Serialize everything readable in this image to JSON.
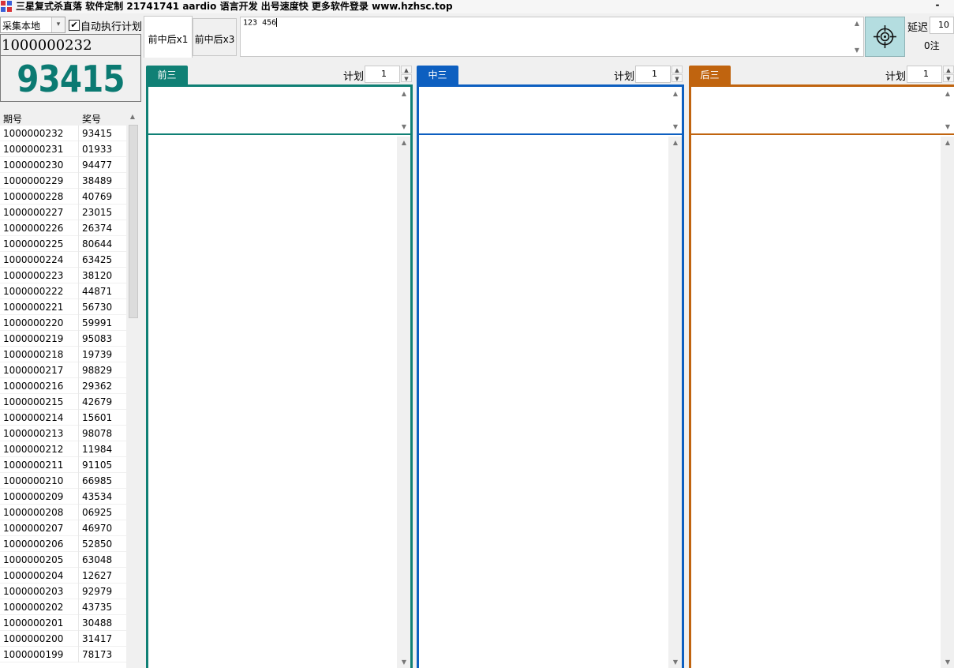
{
  "window": {
    "title": "三星复式杀直落 软件定制 21741741 aardio 语言开发 出号速度快 更多软件登录 www.hzhsc.top",
    "minimize": "-"
  },
  "controls": {
    "source_select": "采集本地",
    "auto_exec_label": "自动执行计划",
    "auto_exec_checked": true
  },
  "current": {
    "issue": "1000000232",
    "result": "93415",
    "result_color": "#0b7a72"
  },
  "history": {
    "headers": [
      "期号",
      "奖号"
    ],
    "rows": [
      [
        "1000000232",
        "93415"
      ],
      [
        "1000000231",
        "01933"
      ],
      [
        "1000000230",
        "94477"
      ],
      [
        "1000000229",
        "38489"
      ],
      [
        "1000000228",
        "40769"
      ],
      [
        "1000000227",
        "23015"
      ],
      [
        "1000000226",
        "26374"
      ],
      [
        "1000000225",
        "80644"
      ],
      [
        "1000000224",
        "63425"
      ],
      [
        "1000000223",
        "38120"
      ],
      [
        "1000000222",
        "44871"
      ],
      [
        "1000000221",
        "56730"
      ],
      [
        "1000000220",
        "59991"
      ],
      [
        "1000000219",
        "95083"
      ],
      [
        "1000000218",
        "19739"
      ],
      [
        "1000000217",
        "98829"
      ],
      [
        "1000000216",
        "29362"
      ],
      [
        "1000000215",
        "42679"
      ],
      [
        "1000000214",
        "15601"
      ],
      [
        "1000000213",
        "98078"
      ],
      [
        "1000000212",
        "11984"
      ],
      [
        "1000000211",
        "91105"
      ],
      [
        "1000000210",
        "66985"
      ],
      [
        "1000000209",
        "43534"
      ],
      [
        "1000000208",
        "06925"
      ],
      [
        "1000000207",
        "46970"
      ],
      [
        "1000000206",
        "52850"
      ],
      [
        "1000000205",
        "63048"
      ],
      [
        "1000000204",
        "12627"
      ],
      [
        "1000000203",
        "92979"
      ],
      [
        "1000000202",
        "43735"
      ],
      [
        "1000000201",
        "30488"
      ],
      [
        "1000000200",
        "31417"
      ],
      [
        "1000000199",
        "78173"
      ]
    ]
  },
  "mode_tabs": [
    {
      "label": "前中后x1",
      "active": true
    },
    {
      "label": "前中后x3",
      "active": false
    }
  ],
  "numbers_input": {
    "value": "123 456"
  },
  "right_panel": {
    "target_icon": "crosshair-icon",
    "delay_label": "延迟",
    "delay_value": "10",
    "bet_count": "0注"
  },
  "columns": [
    {
      "tab": "前三",
      "plan_label": "计划",
      "plan_value": "1",
      "color": "#108075"
    },
    {
      "tab": "中三",
      "plan_label": "计划",
      "plan_value": "1",
      "color": "#0d5fc0"
    },
    {
      "tab": "后三",
      "plan_label": "计划",
      "plan_value": "1",
      "color": "#c0640f"
    }
  ]
}
